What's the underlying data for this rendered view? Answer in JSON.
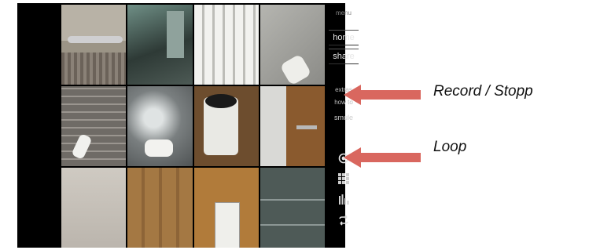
{
  "sidebar": {
    "menu_label": "menu",
    "home_label": "home",
    "share_label": "share",
    "extras_label": "extras",
    "howto_label": "how to",
    "brand_label": "smule",
    "icons": [
      "record-icon",
      "grid-icon",
      "bars-icon",
      "loop-icon"
    ]
  },
  "annotations": {
    "record_label": "Record / Stopp",
    "loop_label": "Loop",
    "arrow_color": "#d9675f"
  }
}
